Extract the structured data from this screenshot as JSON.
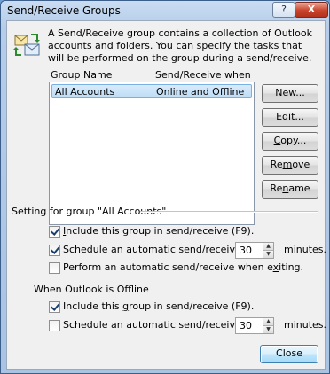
{
  "window": {
    "title": "Send/Receive Groups",
    "help_glyph": "?",
    "close_glyph": "X"
  },
  "description": "A Send/Receive group contains a collection of Outlook accounts and folders. You can specify the tasks that will be performed on the group during a send/receive.",
  "groups_table": {
    "columns": [
      "Group Name",
      "Send/Receive when"
    ],
    "rows": [
      {
        "name": "All Accounts",
        "when": "Online and Offline",
        "selected": true
      }
    ]
  },
  "buttons": {
    "new": {
      "pre": "",
      "key": "N",
      "post": "ew..."
    },
    "edit": {
      "pre": "",
      "key": "E",
      "post": "dit..."
    },
    "copy": {
      "pre": "",
      "key": "C",
      "post": "opy..."
    },
    "remove": {
      "pre": "Re",
      "key": "m",
      "post": "ove"
    },
    "rename": {
      "pre": "Re",
      "key": "n",
      "post": "ame"
    },
    "close": "Close"
  },
  "online_section": {
    "title": "Setting for group \"All Accounts\"",
    "include": {
      "pre": "",
      "key": "I",
      "post": "nclude this group in send/receive (F9).",
      "checked": true
    },
    "schedule": {
      "pre": "Schedule an automatic send/receive e",
      "key": "v",
      "post": "ery",
      "checked": true,
      "minutes": "30",
      "unit": "minutes."
    },
    "exit": {
      "pre": "Perform an automatic send/receive when e",
      "key": "x",
      "post": "iting.",
      "checked": false
    }
  },
  "offline_section": {
    "title": "When Outlook is Offline",
    "include": {
      "pre": "Include this ",
      "key": "g",
      "post": "roup in send/receive (F9).",
      "checked": true
    },
    "schedule": {
      "pre": "Schedule an automatic send/receive eve",
      "key": "r",
      "post": "y",
      "checked": false,
      "minutes": "30",
      "unit": "minutes."
    }
  },
  "colors": {
    "accent": "#3c7fb1",
    "selection": "#bcdcf6"
  },
  "icons": {
    "app": "send-receive-groups-icon"
  }
}
